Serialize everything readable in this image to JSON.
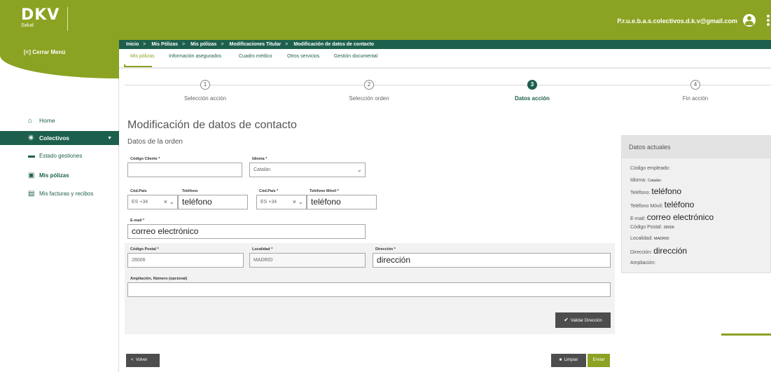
{
  "header": {
    "brand": "DKV",
    "brand_sub": "Salud",
    "user_email": "P.r.u.e.b.a.s.colectivos.d.k.v@gmail.com"
  },
  "sidebar": {
    "close_menu": "[<] Cerrar Menú",
    "items": [
      {
        "label": "Home",
        "icon": "home-icon"
      },
      {
        "label": "Colectivos",
        "icon": "network-icon"
      },
      {
        "label": "Estado gestiones",
        "icon": "card-icon"
      },
      {
        "label": "Mis pólizas",
        "icon": "document-icon"
      },
      {
        "label": "Mis facturas y recibos",
        "icon": "invoice-icon"
      }
    ]
  },
  "breadcrumb": [
    "Inicio",
    "Mis Pólizas",
    "Mis pólizas",
    "Modificaciones Titular",
    "Modificación de datos de contacto"
  ],
  "tabs": [
    "Mis pólizas",
    "Información asegurados",
    "Cuadro médico",
    "Otros servicios",
    "Gestión documental"
  ],
  "steps": [
    {
      "num": "1",
      "label": "Selección acción"
    },
    {
      "num": "2",
      "label": "Selección orden"
    },
    {
      "num": "3",
      "label": "Datos acción"
    },
    {
      "num": "4",
      "label": "Fin acción"
    }
  ],
  "page_title": "Modificación de datos de contacto",
  "section_title": "Datos de la orden",
  "form": {
    "codigo_cliente_label": "Código Cliente *",
    "codigo_cliente_value": "",
    "idioma_label": "Idioma *",
    "idioma_value": "Catalán",
    "cod_pais_label": "Cód.País",
    "cod_pais_value": "ES +34",
    "telefono_label": "Teléfono",
    "telefono_value": "teléfono",
    "cod_pais_movil_label": "Cód.País *",
    "cod_pais_movil_value": "ES +34",
    "telefono_movil_label": "Teléfono Móvil *",
    "telefono_movil_value": "teléfono",
    "email_label": "E-mail *",
    "email_value": "correo electrónico",
    "codigo_postal_label": "Código Postal *",
    "codigo_postal_value": "28006",
    "localidad_label": "Localidad *",
    "localidad_value": "MADRID",
    "direccion_label": "Dirección *",
    "direccion_value": "dirección",
    "ampliacion_label": "Ampliación, Número (opcional)",
    "ampliacion_value": "",
    "validate_label": "Validar Dirección"
  },
  "buttons": {
    "back": "Volver",
    "clean": "Limpiar",
    "send": "Enviar"
  },
  "current": {
    "title": "Datos actuales",
    "codigo_empleado_label": "Código empleado:",
    "idioma_label": "Idioma:",
    "idioma_value": "Catalán",
    "telefono_label": "Teléfono:",
    "telefono_value": "teléfono",
    "telefono_movil_label": "Teléfono Móvil:",
    "telefono_movil_value": "teléfono",
    "email_label": "E-mail:",
    "email_value": "correo electrónico",
    "codigo_postal_label": "Código Postal:",
    "codigo_postal_value": "28006",
    "localidad_label": "Localidad:",
    "localidad_value": "MADRID",
    "direccion_label": "Dirección:",
    "direccion_value": "dirección",
    "ampliacion_label": "Ampliación:"
  },
  "colors": {
    "brand_green": "#8aa322",
    "dark_green": "#1d5f4d",
    "button_dark": "#4d4d4d"
  }
}
